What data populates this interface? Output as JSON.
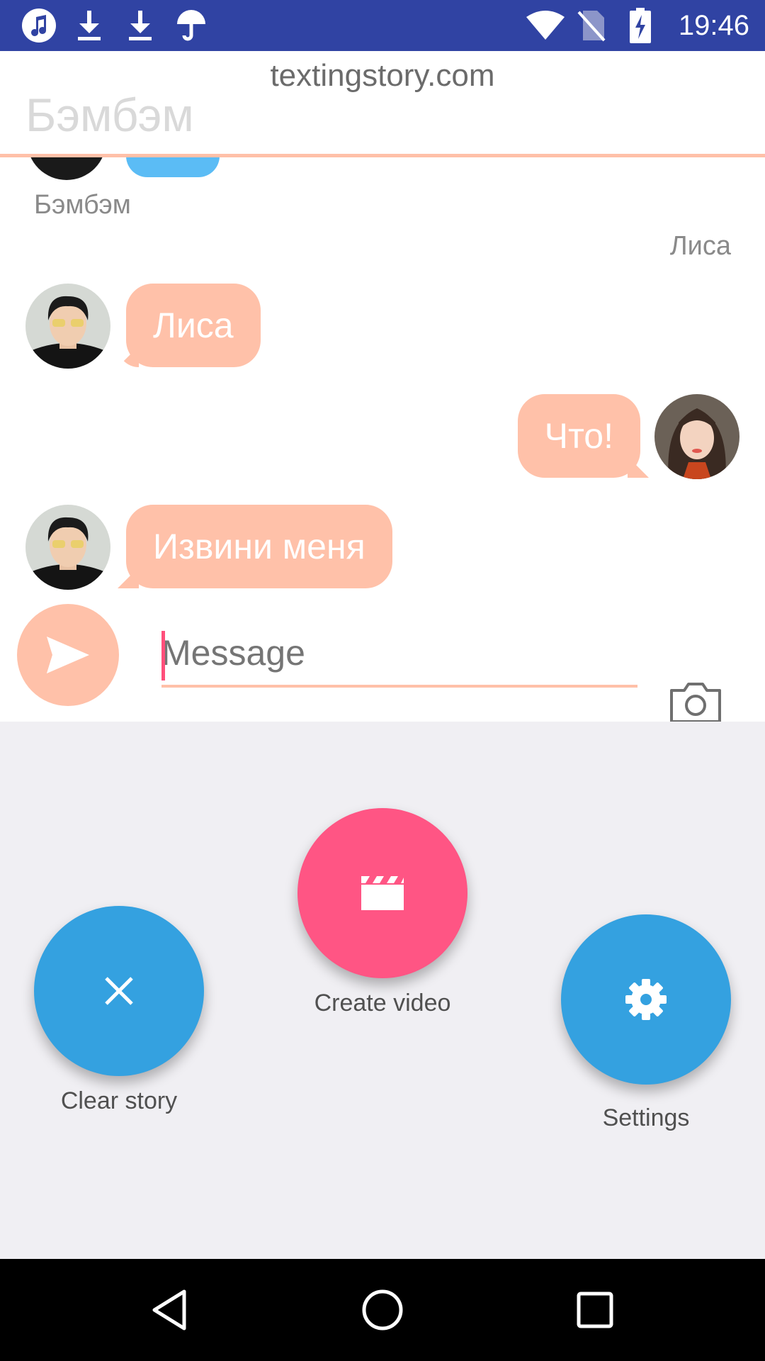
{
  "status_bar": {
    "time": "19:46",
    "left_icons": [
      "music-icon",
      "download-icon",
      "download-icon",
      "umbrella-icon"
    ],
    "right_icons": [
      "wifi-icon",
      "no-sim-icon",
      "battery-charging-icon"
    ],
    "bg_color": "#3043a3"
  },
  "chat": {
    "watermark": "textingstory.com",
    "title_field_value": "Бэмбэм",
    "top_partial_sender": "Бэмбэм",
    "right_sender": "Лиса",
    "messages": [
      {
        "side": "left",
        "text": "Лиса",
        "avatar": "boy-avatar"
      },
      {
        "side": "right",
        "text": "Что!",
        "avatar": "girl-avatar"
      },
      {
        "side": "left",
        "text": "Извини меня",
        "avatar": "boy-avatar"
      }
    ],
    "bubble_color": "#ffc1a9",
    "partial_bubble_color": "#5bbcf5"
  },
  "composer": {
    "placeholder": "Message",
    "accent_color": "#ffc0a8",
    "cursor_color": "#ff4f7b"
  },
  "actions": {
    "clear_story_label": "Clear story",
    "create_video_label": "Create video",
    "settings_label": "Settings",
    "blue": "#34a1e0",
    "pink": "#ff5584"
  },
  "nav": [
    "back-icon",
    "home-icon",
    "recents-icon"
  ]
}
